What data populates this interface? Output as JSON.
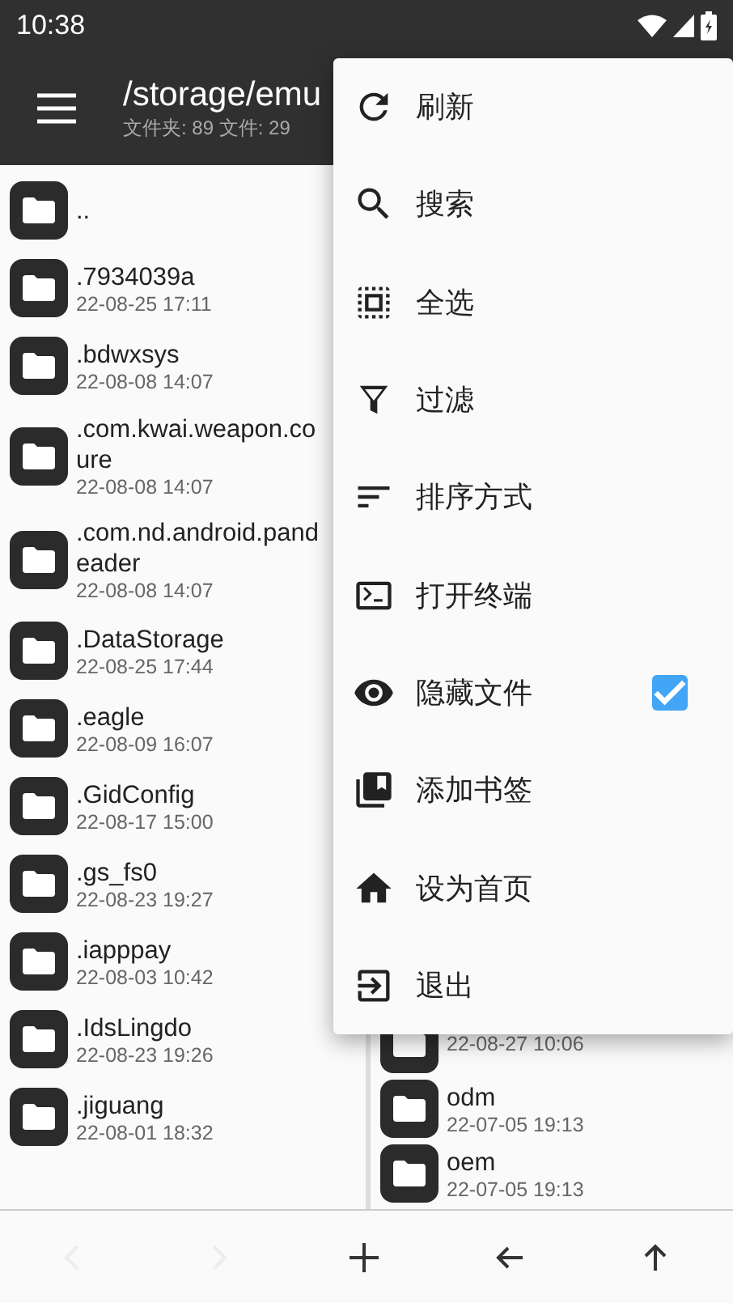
{
  "status_bar": {
    "time": "10:38"
  },
  "app_bar": {
    "title": "/storage/emu",
    "subtitle": "文件夹: 89  文件: 29"
  },
  "left_pane": {
    "rows": [
      {
        "lines": [
          ".."
        ]
      },
      {
        "lines": [
          ".7934039a"
        ],
        "date": "22-08-25 17:11"
      },
      {
        "lines": [
          ".bdwxsys"
        ],
        "date": "22-08-08 14:07"
      },
      {
        "lines": [
          ".com.kwai.weapon.co",
          "ure"
        ],
        "date": "22-08-08 14:07"
      },
      {
        "lines": [
          ".com.nd.android.pand",
          "eader"
        ],
        "date": "22-08-08 14:07"
      },
      {
        "lines": [
          ".DataStorage"
        ],
        "date": "22-08-25 17:44"
      },
      {
        "lines": [
          ".eagle"
        ],
        "date": "22-08-09 16:07"
      },
      {
        "lines": [
          ".GidConfig"
        ],
        "date": "22-08-17 15:00"
      },
      {
        "lines": [
          ".gs_fs0"
        ],
        "date": "22-08-23 19:27"
      },
      {
        "lines": [
          ".iapppay"
        ],
        "date": "22-08-03 10:42"
      },
      {
        "lines": [
          ".IdsLingdo"
        ],
        "date": "22-08-23 19:26"
      },
      {
        "lines": [
          ".jiguang"
        ],
        "date": "22-08-01 18:32"
      }
    ]
  },
  "right_pane": {
    "rows": [
      {
        "lines": [],
        "date": "22-08-27 10:06"
      },
      {
        "lines": [
          "odm"
        ],
        "date": "22-07-05 19:13"
      },
      {
        "lines": [
          "oem"
        ],
        "date": "22-07-05 19:13"
      }
    ]
  },
  "menu": {
    "items": [
      {
        "kind": "refresh",
        "label": "刷新"
      },
      {
        "kind": "search",
        "label": "搜索"
      },
      {
        "kind": "select-all",
        "label": "全选"
      },
      {
        "kind": "filter",
        "label": "过滤"
      },
      {
        "kind": "sort",
        "label": "排序方式"
      },
      {
        "kind": "terminal",
        "label": "打开终端"
      },
      {
        "kind": "eye",
        "label": "隐藏文件",
        "checked": true
      },
      {
        "kind": "bookmark",
        "label": "添加书签"
      },
      {
        "kind": "home",
        "label": "设为首页"
      },
      {
        "kind": "exit",
        "label": "退出"
      }
    ]
  },
  "bottom_bar": [
    {
      "kind": "back",
      "disabled": true
    },
    {
      "kind": "forward",
      "disabled": true
    },
    {
      "kind": "add",
      "disabled": false
    },
    {
      "kind": "arrow-left",
      "disabled": false
    },
    {
      "kind": "arrow-up",
      "disabled": false
    }
  ]
}
